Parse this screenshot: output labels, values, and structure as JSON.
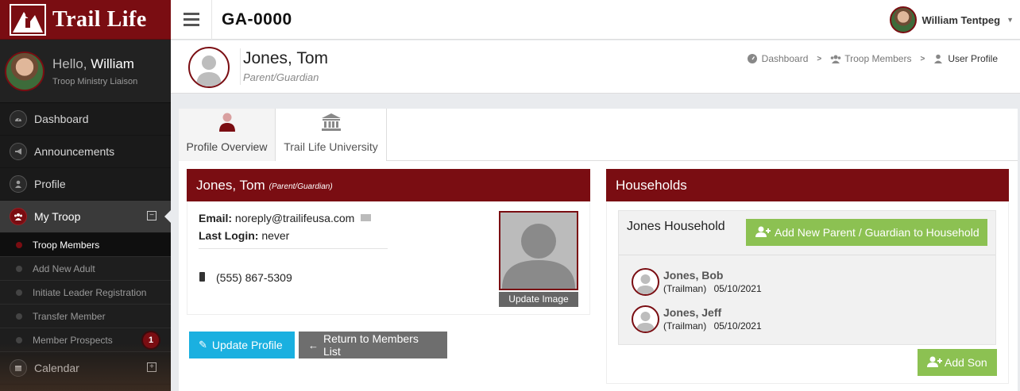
{
  "app": {
    "brand": "Trail Life",
    "troop_code": "GA-0000"
  },
  "sidebar": {
    "hello_prefix": "Hello,",
    "user_first": "William",
    "user_role": "Troop Ministry Liaison",
    "items": [
      {
        "label": "Dashboard",
        "icon": "dashboard-icon"
      },
      {
        "label": "Announcements",
        "icon": "bullhorn-icon"
      },
      {
        "label": "Profile",
        "icon": "user-icon"
      },
      {
        "label": "My Troop",
        "icon": "users-icon"
      },
      {
        "label": "Calendar",
        "icon": "calendar-icon"
      }
    ],
    "sub_items": [
      {
        "label": "Troop Members"
      },
      {
        "label": "Add New Adult"
      },
      {
        "label": "Initiate Leader Registration"
      },
      {
        "label": "Transfer Member"
      },
      {
        "label": "Member Prospects",
        "badge": "1"
      }
    ]
  },
  "topbar": {
    "user_name": "William Tentpeg"
  },
  "page_header": {
    "name": "Jones, Tom",
    "role": "Parent/Guardian",
    "breadcrumb": [
      "Dashboard",
      "Troop Members",
      "User Profile"
    ]
  },
  "tabs": [
    {
      "label": "Profile Overview",
      "icon": "person-icon"
    },
    {
      "label": "Trail Life University",
      "icon": "university-icon"
    }
  ],
  "profile": {
    "title": "Jones, Tom",
    "title_sub": "(Parent/Guardian)",
    "email_label": "Email:",
    "email": "noreply@trailifeusa.com",
    "last_login_label": "Last Login:",
    "last_login": "never",
    "phone": "(555) 867-5309",
    "update_image": "Update Image",
    "update_profile": "Update Profile",
    "return_list": "Return to Members List"
  },
  "households": {
    "title": "Households",
    "household_name": "Jones Household",
    "add_parent": "Add New Parent / Guardian to Household",
    "add_son": "Add Son",
    "members": [
      {
        "name": "Jones, Bob",
        "role": "(Trailman)",
        "date": "05/10/2021"
      },
      {
        "name": "Jones, Jeff",
        "role": "(Trailman)",
        "date": "05/10/2021"
      }
    ]
  },
  "colors": {
    "brand": "#7a0d12",
    "blue": "#1ab0e0",
    "green": "#8cc152",
    "gray": "#6e6e6e"
  }
}
